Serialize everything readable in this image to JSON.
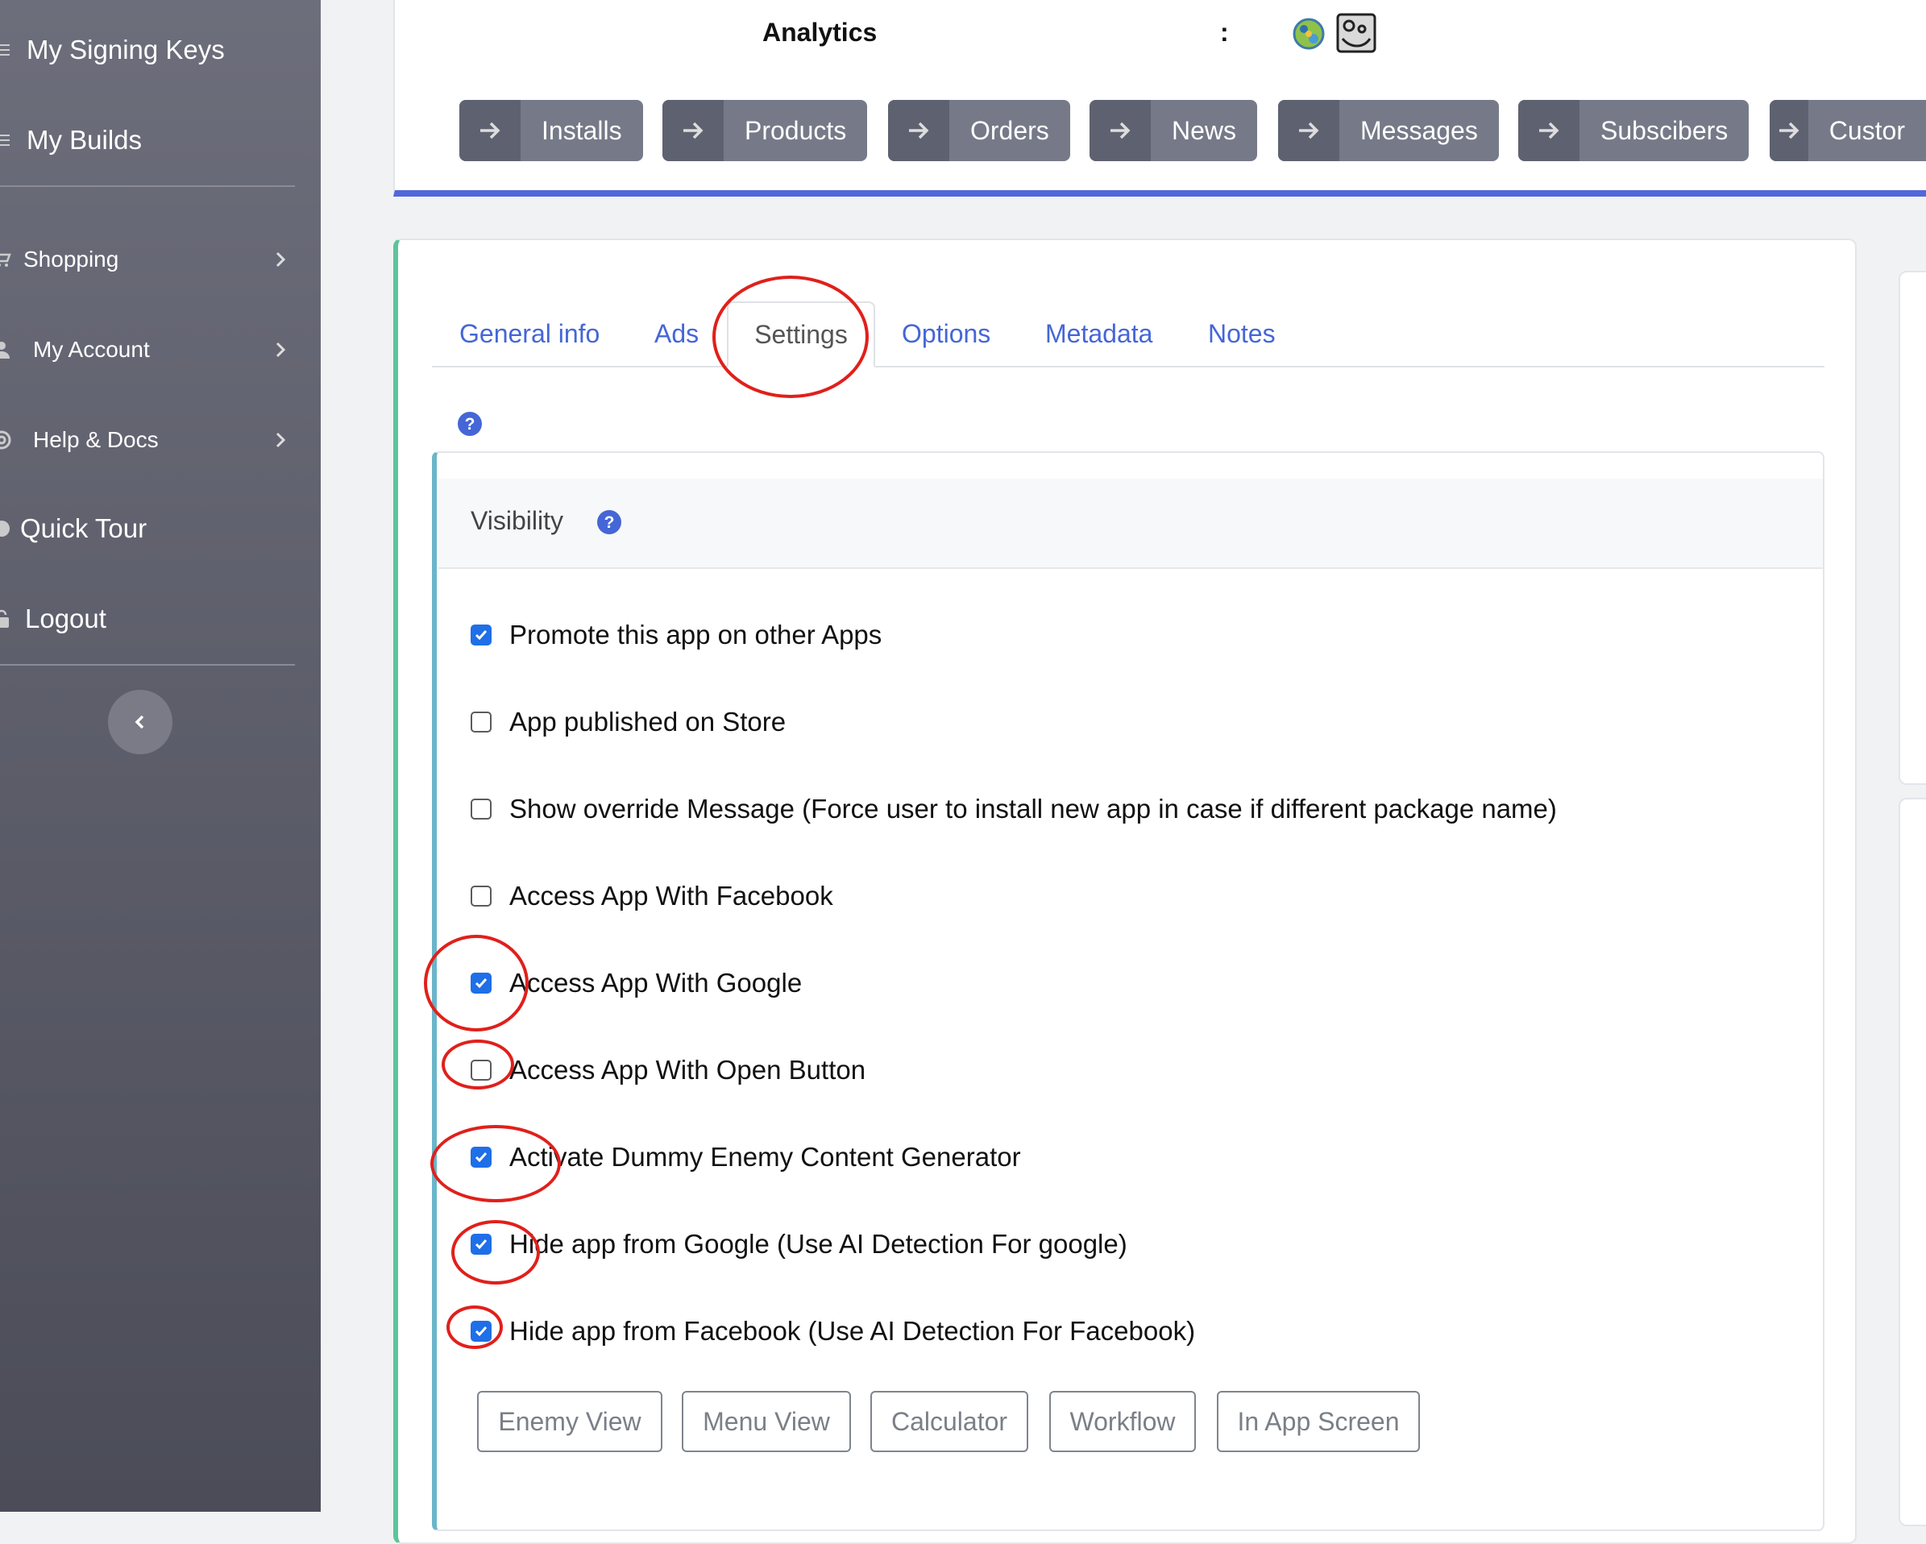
{
  "sidebar": {
    "items": [
      {
        "label": "My Signing Keys",
        "icon": "list-icon"
      },
      {
        "label": "My Builds",
        "icon": "list-icon"
      },
      {
        "label": "Shopping",
        "icon": "cart-icon"
      },
      {
        "label": "My Account",
        "icon": "user-icon"
      },
      {
        "label": "Help & Docs",
        "icon": "lifebuoy-icon"
      },
      {
        "label": "Quick Tour",
        "icon": "circle-icon"
      },
      {
        "label": "Logout",
        "icon": "lock-icon"
      }
    ]
  },
  "header": {
    "title": "Analytics",
    "colon": ":",
    "nav_buttons": [
      "Installs",
      "Products",
      "Orders",
      "News",
      "Messages",
      "Subscibers",
      "Custor"
    ]
  },
  "tabs": [
    "General info",
    "Ads",
    "Settings",
    "Options",
    "Metadata",
    "Notes"
  ],
  "active_tab": "Settings",
  "visibility": {
    "title": "Visibility",
    "options": [
      {
        "label": "Promote this app on other Apps",
        "checked": true
      },
      {
        "label": "App published on Store",
        "checked": false
      },
      {
        "label": "Show override Message (Force user to install new app in case if different package name)",
        "checked": false
      },
      {
        "label": "Access App With Facebook",
        "checked": false
      },
      {
        "label": "Access App With Google",
        "checked": true
      },
      {
        "label": "Access App With Open Button",
        "checked": false
      },
      {
        "label": "Activate Dummy Enemy Content Generator",
        "checked": true
      },
      {
        "label": "Hide app from Google (Use AI Detection For google)",
        "checked": true
      },
      {
        "label": "Hide app from Facebook (Use AI Detection For Facebook)",
        "checked": true
      }
    ],
    "buttons": [
      "Enemy View",
      "Menu View",
      "Calculator",
      "Workflow",
      "In App Screen"
    ]
  },
  "colors": {
    "sidebar": "#5a5b67",
    "accent_blue": "#4566d6",
    "checkbox_blue": "#1f6fe8",
    "annotation_red": "#e0201b",
    "nav_button": "#767a88"
  }
}
